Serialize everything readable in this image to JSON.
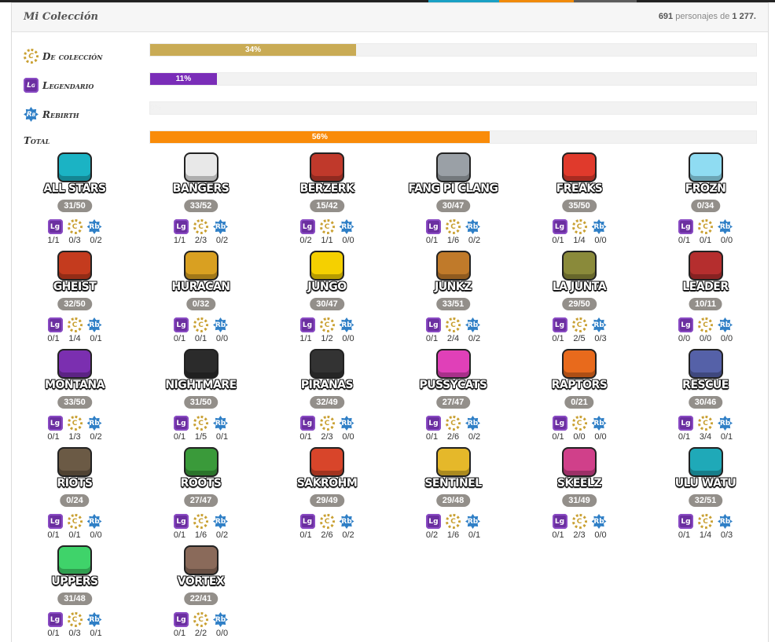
{
  "header": {
    "title": "Mi Colección",
    "count_owned": "691",
    "count_text": "personajes de",
    "count_total": "1 277."
  },
  "colors": {
    "gold": "#c9ab55",
    "legendary": "#7a2db8",
    "rebirth": "#2f7fc6",
    "total": "#f98b09",
    "pill": "#938f8a"
  },
  "stats": [
    {
      "key": "coleccion",
      "label": "De colección",
      "icon": "gold-c-icon",
      "percent_text": "34%",
      "value": 34,
      "color": "#c9ab55"
    },
    {
      "key": "legendario",
      "label": "Legendario",
      "icon": "legendary-l-icon",
      "percent_text": "11%",
      "value": 11,
      "color": "#7a2db8"
    },
    {
      "key": "rebirth",
      "label": "Rebirth",
      "icon": "rebirth-rb-icon",
      "percent_text": "0%",
      "value": 0,
      "color": "#2f7fc6"
    },
    {
      "key": "total",
      "label": "Total",
      "icon": "",
      "percent_text": "56%",
      "value": 56,
      "color": "#f98b09"
    }
  ],
  "icon_letters": {
    "legendary": "Lg",
    "gold": "C",
    "rebirth": "Rb"
  },
  "teams": [
    {
      "name": "ALL STARS",
      "emblem": "jersey-99-emblem",
      "emblem_color": "#1bb3c4",
      "progress": "31/50",
      "legendary": "1/1",
      "gold": "0/3",
      "rebirth": "0/2"
    },
    {
      "name": "BANGERS",
      "emblem": "b-letter-emblem",
      "emblem_color": "#e8e8e8",
      "progress": "33/52",
      "legendary": "1/1",
      "gold": "2/3",
      "rebirth": "0/2"
    },
    {
      "name": "BERZERK",
      "emblem": "fist-emblem",
      "emblem_color": "#c0392b",
      "progress": "15/42",
      "legendary": "0/2",
      "gold": "1/1",
      "rebirth": "0/0"
    },
    {
      "name": "FANG PI CLANG",
      "emblem": "shuriken-emblem",
      "emblem_color": "#9aa0a6",
      "progress": "30/47",
      "legendary": "0/1",
      "gold": "1/6",
      "rebirth": "0/2"
    },
    {
      "name": "FREAKS",
      "emblem": "crab-emblem",
      "emblem_color": "#e03a2c",
      "progress": "35/50",
      "legendary": "0/1",
      "gold": "1/4",
      "rebirth": "0/0"
    },
    {
      "name": "FROZN",
      "emblem": "snowflake-emblem",
      "emblem_color": "#8fdcf2",
      "progress": "0/34",
      "legendary": "0/1",
      "gold": "0/1",
      "rebirth": "0/0"
    },
    {
      "name": "GHEIST",
      "emblem": "skull-emblem",
      "emblem_color": "#c43b1e",
      "progress": "32/50",
      "legendary": "0/1",
      "gold": "1/4",
      "rebirth": "0/1"
    },
    {
      "name": "HURACAN",
      "emblem": "mask-emblem",
      "emblem_color": "#d9a021",
      "progress": "0/32",
      "legendary": "0/1",
      "gold": "0/1",
      "rebirth": "0/0"
    },
    {
      "name": "JUNGO",
      "emblem": "paw-emblem",
      "emblem_color": "#f5d000",
      "progress": "30/47",
      "legendary": "1/1",
      "gold": "1/2",
      "rebirth": "0/0"
    },
    {
      "name": "JUNKZ",
      "emblem": "goggles-emblem",
      "emblem_color": "#c07a2a",
      "progress": "33/51",
      "legendary": "0/1",
      "gold": "2/4",
      "rebirth": "0/2"
    },
    {
      "name": "LA JUNTA",
      "emblem": "rocket-emblem",
      "emblem_color": "#8a8a3a",
      "progress": "29/50",
      "legendary": "0/1",
      "gold": "2/5",
      "rebirth": "0/3"
    },
    {
      "name": "LEADER",
      "emblem": "chevron-emblem",
      "emblem_color": "#b52e2e",
      "progress": "10/11",
      "legendary": "0/0",
      "gold": "0/0",
      "rebirth": "0/0"
    },
    {
      "name": "MONTANA",
      "emblem": "hat-emblem",
      "emblem_color": "#7b2fb0",
      "progress": "33/50",
      "legendary": "0/1",
      "gold": "1/3",
      "rebirth": "0/2"
    },
    {
      "name": "NIGHTMARE",
      "emblem": "bat-emblem",
      "emblem_color": "#2b2b2b",
      "progress": "31/50",
      "legendary": "0/1",
      "gold": "1/5",
      "rebirth": "0/1"
    },
    {
      "name": "PIRANAS",
      "emblem": "flag-emblem",
      "emblem_color": "#333333",
      "progress": "32/49",
      "legendary": "0/1",
      "gold": "2/3",
      "rebirth": "0/0"
    },
    {
      "name": "PUSSYCATS",
      "emblem": "cat-emblem",
      "emblem_color": "#e040b8",
      "progress": "27/47",
      "legendary": "0/1",
      "gold": "2/6",
      "rebirth": "0/2"
    },
    {
      "name": "RAPTORS",
      "emblem": "horns-emblem",
      "emblem_color": "#e86a1c",
      "progress": "0/21",
      "legendary": "0/1",
      "gold": "0/0",
      "rebirth": "0/0"
    },
    {
      "name": "RESCUE",
      "emblem": "r-shield-emblem",
      "emblem_color": "#5561a8",
      "progress": "30/46",
      "legendary": "0/1",
      "gold": "3/4",
      "rebirth": "0/1"
    },
    {
      "name": "RIOTS",
      "emblem": "gear-emblem",
      "emblem_color": "#6b5a45",
      "progress": "0/24",
      "legendary": "0/1",
      "gold": "0/1",
      "rebirth": "0/0"
    },
    {
      "name": "ROOTS",
      "emblem": "star-circle-emblem",
      "emblem_color": "#3a9a3a",
      "progress": "27/47",
      "legendary": "0/1",
      "gold": "1/6",
      "rebirth": "0/2"
    },
    {
      "name": "SAKROHM",
      "emblem": "planet-emblem",
      "emblem_color": "#d8452a",
      "progress": "29/49",
      "legendary": "0/1",
      "gold": "2/6",
      "rebirth": "0/2"
    },
    {
      "name": "SENTINEL",
      "emblem": "gold-star-emblem",
      "emblem_color": "#e5b82a",
      "progress": "29/48",
      "legendary": "0/2",
      "gold": "1/6",
      "rebirth": "0/1"
    },
    {
      "name": "SKEELZ",
      "emblem": "s-shield-emblem",
      "emblem_color": "#d0408a",
      "progress": "31/49",
      "legendary": "0/1",
      "gold": "2/3",
      "rebirth": "0/0"
    },
    {
      "name": "ULU WATU",
      "emblem": "wave-emblem",
      "emblem_color": "#1fa9b8",
      "progress": "32/51",
      "legendary": "0/1",
      "gold": "1/4",
      "rebirth": "0/3"
    },
    {
      "name": "UPPERS",
      "emblem": "gem-emblem",
      "emblem_color": "#3fd36a",
      "progress": "31/48",
      "legendary": "0/1",
      "gold": "0/3",
      "rebirth": "0/1"
    },
    {
      "name": "VORTEX",
      "emblem": "x-emblem",
      "emblem_color": "#8a6a5a",
      "progress": "22/41",
      "legendary": "0/1",
      "gold": "2/2",
      "rebirth": "0/0"
    }
  ]
}
